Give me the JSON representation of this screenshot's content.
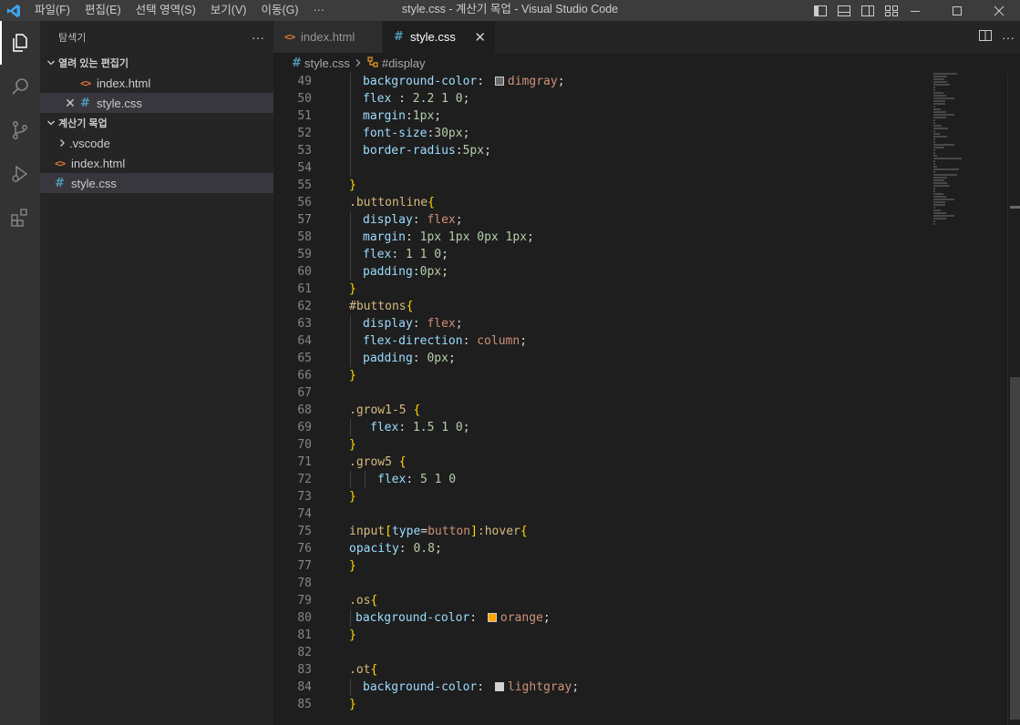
{
  "titlebar": {
    "menu": [
      "파일(F)",
      "편집(E)",
      "선택 영역(S)",
      "보기(V)",
      "이동(G)",
      "···"
    ],
    "title": "style.css - 계산기 목업 - Visual Studio Code"
  },
  "sidebar": {
    "title": "탐색기",
    "more": "···",
    "open_editors": {
      "header": "열려 있는 편집기",
      "items": [
        {
          "name": "index.html",
          "type": "html"
        },
        {
          "name": "style.css",
          "type": "css"
        }
      ]
    },
    "workspace": {
      "header": "계산기 목업",
      "items": [
        {
          "name": ".vscode",
          "type": "folder"
        },
        {
          "name": "index.html",
          "type": "html"
        },
        {
          "name": "style.css",
          "type": "css"
        }
      ]
    }
  },
  "tabs": [
    {
      "label": "index.html",
      "active": false
    },
    {
      "label": "style.css",
      "active": true
    }
  ],
  "breadcrumb": {
    "file": "style.css",
    "symbol": "#display"
  },
  "code": {
    "lines": [
      {
        "n": "49",
        "indent": 1,
        "tokens": [
          [
            "prop",
            "background-color"
          ],
          [
            "punc",
            ": "
          ],
          [
            "swatch",
            "#696969"
          ],
          [
            "val",
            "dimgray"
          ],
          [
            "punc",
            ";"
          ]
        ]
      },
      {
        "n": "50",
        "indent": 1,
        "tokens": [
          [
            "prop",
            "flex"
          ],
          [
            "punc",
            " : "
          ],
          [
            "num",
            "2.2 1 0"
          ],
          [
            "punc",
            ";"
          ]
        ]
      },
      {
        "n": "51",
        "indent": 1,
        "tokens": [
          [
            "prop",
            "margin"
          ],
          [
            "punc",
            ":"
          ],
          [
            "num",
            "1px"
          ],
          [
            "punc",
            ";"
          ]
        ]
      },
      {
        "n": "52",
        "indent": 1,
        "tokens": [
          [
            "prop",
            "font-size"
          ],
          [
            "punc",
            ":"
          ],
          [
            "num",
            "30px"
          ],
          [
            "punc",
            ";"
          ]
        ]
      },
      {
        "n": "53",
        "indent": 1,
        "tokens": [
          [
            "prop",
            "border-radius"
          ],
          [
            "punc",
            ":"
          ],
          [
            "num",
            "5px"
          ],
          [
            "punc",
            ";"
          ]
        ]
      },
      {
        "n": "54",
        "indent": 1,
        "tokens": []
      },
      {
        "n": "55",
        "indent": 0,
        "tokens": [
          [
            "brace",
            "}"
          ]
        ]
      },
      {
        "n": "56",
        "indent": 0,
        "tokens": [
          [
            "sel",
            ".buttonline"
          ],
          [
            "brace",
            "{"
          ]
        ]
      },
      {
        "n": "57",
        "indent": 1,
        "tokens": [
          [
            "prop",
            "display"
          ],
          [
            "punc",
            ": "
          ],
          [
            "val",
            "flex"
          ],
          [
            "punc",
            ";"
          ]
        ]
      },
      {
        "n": "58",
        "indent": 1,
        "tokens": [
          [
            "prop",
            "margin"
          ],
          [
            "punc",
            ": "
          ],
          [
            "num",
            "1px 1px 0px 1px"
          ],
          [
            "punc",
            ";"
          ]
        ]
      },
      {
        "n": "59",
        "indent": 1,
        "tokens": [
          [
            "prop",
            "flex"
          ],
          [
            "punc",
            ": "
          ],
          [
            "num",
            "1 1 0"
          ],
          [
            "punc",
            ";"
          ]
        ]
      },
      {
        "n": "60",
        "indent": 1,
        "tokens": [
          [
            "prop",
            "padding"
          ],
          [
            "punc",
            ":"
          ],
          [
            "num",
            "0px"
          ],
          [
            "punc",
            ";"
          ]
        ]
      },
      {
        "n": "61",
        "indent": 0,
        "tokens": [
          [
            "brace",
            "}"
          ]
        ]
      },
      {
        "n": "62",
        "indent": 0,
        "tokens": [
          [
            "sel",
            "#buttons"
          ],
          [
            "brace",
            "{"
          ]
        ]
      },
      {
        "n": "63",
        "indent": 1,
        "tokens": [
          [
            "prop",
            "display"
          ],
          [
            "punc",
            ": "
          ],
          [
            "val",
            "flex"
          ],
          [
            "punc",
            ";"
          ]
        ]
      },
      {
        "n": "64",
        "indent": 1,
        "tokens": [
          [
            "prop",
            "flex-direction"
          ],
          [
            "punc",
            ": "
          ],
          [
            "val",
            "column"
          ],
          [
            "punc",
            ";"
          ]
        ]
      },
      {
        "n": "65",
        "indent": 1,
        "tokens": [
          [
            "prop",
            "padding"
          ],
          [
            "punc",
            ": "
          ],
          [
            "num",
            "0px"
          ],
          [
            "punc",
            ";"
          ]
        ]
      },
      {
        "n": "66",
        "indent": 0,
        "tokens": [
          [
            "brace",
            "}"
          ]
        ]
      },
      {
        "n": "67",
        "indent": 0,
        "tokens": []
      },
      {
        "n": "68",
        "indent": 0,
        "tokens": [
          [
            "sel",
            ".grow1-5 "
          ],
          [
            "brace",
            "{"
          ]
        ]
      },
      {
        "n": "69",
        "indent": 2,
        "tokens": [
          [
            "prop",
            "flex"
          ],
          [
            "punc",
            ": "
          ],
          [
            "num",
            "1.5 1 0"
          ],
          [
            "punc",
            ";"
          ]
        ]
      },
      {
        "n": "70",
        "indent": 0,
        "tokens": [
          [
            "brace",
            "}"
          ]
        ]
      },
      {
        "n": "71",
        "indent": 0,
        "tokens": [
          [
            "sel",
            ".grow5 "
          ],
          [
            "brace",
            "{"
          ]
        ]
      },
      {
        "n": "72",
        "indent": 3,
        "tokens": [
          [
            "prop",
            "flex"
          ],
          [
            "punc",
            ": "
          ],
          [
            "num",
            "5 1 0"
          ]
        ]
      },
      {
        "n": "73",
        "indent": 0,
        "tokens": [
          [
            "brace",
            "}"
          ]
        ]
      },
      {
        "n": "74",
        "indent": 0,
        "tokens": []
      },
      {
        "n": "75",
        "indent": 0,
        "tokens": [
          [
            "sel",
            "input"
          ],
          [
            "brace",
            "["
          ],
          [
            "attr",
            "type"
          ],
          [
            "punc",
            "="
          ],
          [
            "val",
            "button"
          ],
          [
            "brace",
            "]"
          ],
          [
            "sel",
            ":hover"
          ],
          [
            "brace",
            "{"
          ]
        ]
      },
      {
        "n": "76",
        "indent": 0,
        "tokens": [
          [
            "prop",
            "opacity"
          ],
          [
            "punc",
            ": "
          ],
          [
            "num",
            "0.8"
          ],
          [
            "punc",
            ";"
          ]
        ]
      },
      {
        "n": "77",
        "indent": 0,
        "tokens": [
          [
            "brace",
            "}"
          ]
        ]
      },
      {
        "n": "78",
        "indent": 0,
        "tokens": []
      },
      {
        "n": "79",
        "indent": 0,
        "tokens": [
          [
            "sel",
            ".os"
          ],
          [
            "brace",
            "{"
          ]
        ]
      },
      {
        "n": "80",
        "indent": 4,
        "tokens": [
          [
            "prop",
            "background-color"
          ],
          [
            "punc",
            ": "
          ],
          [
            "swatch",
            "#ffa500"
          ],
          [
            "val",
            "orange"
          ],
          [
            "punc",
            ";"
          ]
        ]
      },
      {
        "n": "81",
        "indent": 0,
        "tokens": [
          [
            "brace",
            "}"
          ]
        ]
      },
      {
        "n": "82",
        "indent": 0,
        "tokens": []
      },
      {
        "n": "83",
        "indent": 0,
        "tokens": [
          [
            "sel",
            ".ot"
          ],
          [
            "brace",
            "{"
          ]
        ]
      },
      {
        "n": "84",
        "indent": 1,
        "tokens": [
          [
            "prop",
            "background-color"
          ],
          [
            "punc",
            ": "
          ],
          [
            "swatch",
            "#d3d3d3"
          ],
          [
            "val",
            "lightgray"
          ],
          [
            "punc",
            ";"
          ]
        ]
      },
      {
        "n": "85",
        "indent": 0,
        "tokens": [
          [
            "brace",
            "}"
          ]
        ]
      }
    ]
  },
  "colors": {
    "titlebar_bg": "#3c3c3c",
    "activity_bg": "#333333",
    "sidebar_bg": "#252526",
    "editor_bg": "#1e1e1e",
    "accent_blue": "#007acc",
    "html_icon": "#e37933",
    "css_icon": "#519aba"
  }
}
